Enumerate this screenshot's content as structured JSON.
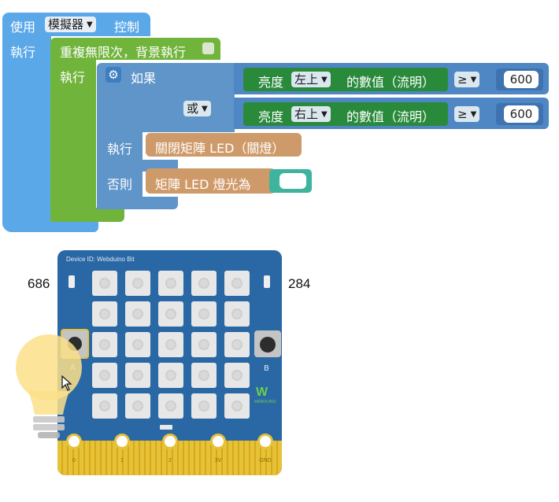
{
  "colors": {
    "outer_block": "#5ba8e9",
    "repeat_block": "#71b43c",
    "if_block": "#5f95c9",
    "sensor_block": "#2a8a3c",
    "compare_block": "#4f87c4",
    "led_block": "#cf9a69",
    "color_input": "#3eb49f",
    "board": "#2a67a5",
    "gold": "#e6c23a"
  },
  "blocks": {
    "use_label": "使用",
    "use_dropdown": "模擬器",
    "control_label": "控制",
    "exec1": "執行",
    "repeat_label": "重複無限次，背景執行",
    "exec2": "執行",
    "if_label": "如果",
    "or_dropdown": "或",
    "cond1": {
      "prefix": "亮度",
      "dropdown": "左上",
      "suffix": "的數值（流明）",
      "op": "≥",
      "value": "600"
    },
    "cond2": {
      "prefix": "亮度",
      "dropdown": "右上",
      "suffix": "的數值（流明）",
      "op": "≥",
      "value": "600"
    },
    "then_label": "執行",
    "then_action": "關閉矩陣 LED（關燈）",
    "else_label": "否則",
    "else_action": "矩陣 LED 燈光為"
  },
  "simulator": {
    "left_value": "686",
    "right_value": "284",
    "device_id": "Device ID: Webduino Bit",
    "button_a": "A",
    "button_b": "B",
    "logo_text": "WEBDUINO",
    "pins": [
      "0",
      "1",
      "2",
      "3V",
      "GND"
    ],
    "led_matrix_state": "all-off"
  },
  "icons": {
    "gear": "gear-icon",
    "cursor": "mouse-cursor-icon",
    "bulb": "light-bulb-icon",
    "dropdown": "triangle-down-icon"
  }
}
